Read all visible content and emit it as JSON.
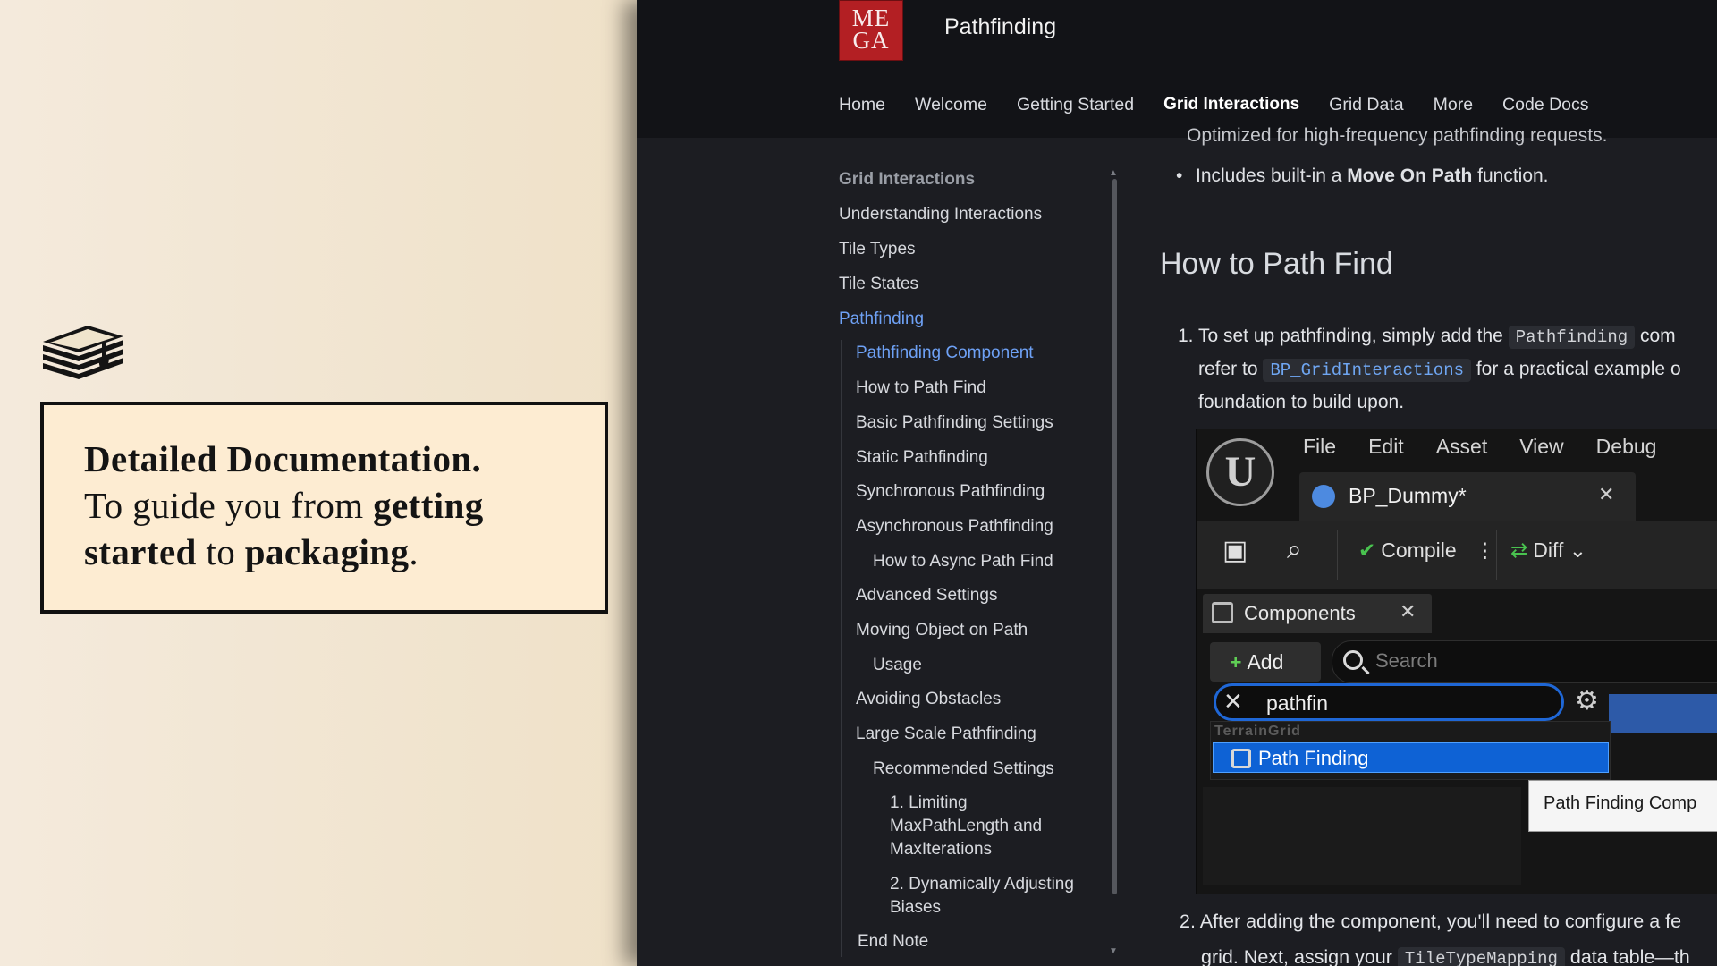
{
  "promo": {
    "headline": "Detailed Documentation.",
    "line_a": "To guide you from ",
    "bold_a": "getting",
    "bold_b": "started",
    "line_b": " to ",
    "bold_c": "packaging",
    "line_c": ".",
    "icon": "books-icon"
  },
  "header": {
    "logo_top": "ME",
    "logo_bottom": "GA",
    "title": "Pathfinding",
    "nav": [
      "Home",
      "Welcome",
      "Getting Started",
      "Grid Interactions",
      "Grid Data",
      "More",
      "Code Docs"
    ],
    "active_nav": "Grid Interactions"
  },
  "sidebar": {
    "section": "Grid Interactions",
    "items": [
      "Understanding Interactions",
      "Tile Types",
      "Tile States",
      "Pathfinding",
      "Pathfinding Component",
      "How to Path Find",
      "Basic Pathfinding Settings",
      "Static Pathfinding",
      "Synchronous Pathfinding",
      "Asynchronous Pathfinding",
      "How to Async Path Find",
      "Advanced Settings",
      "Moving Object on Path",
      "Usage",
      "Avoiding Obstacles",
      "Large Scale Pathfinding",
      "Recommended Settings",
      "1. Limiting",
      "MaxPathLength and",
      "MaxIterations",
      "2. Dynamically Adjusting",
      "Biases",
      "End Note"
    ]
  },
  "content": {
    "cut_line": "Optimized for high-frequency pathfinding requests.",
    "bullet_prefix": "Includes built-in a ",
    "bullet_bold": "Move On Path",
    "bullet_suffix": " function.",
    "heading": "How to Path Find",
    "step1_num": "1.",
    "step1_a": "To set up pathfinding, simply add the ",
    "step1_code": "Pathfinding",
    "step1_b": " com",
    "step1_c": "refer to ",
    "step1_code2": "BP_GridInteractions",
    "step1_d": " for a practical example o",
    "step1_e": "foundation to build upon.",
    "step2_a": "2. After adding the component, you'll need to configure a fe",
    "step2_b_pre": "grid. Next, assign your ",
    "step2_code": "TileTypeMapping",
    "step2_b_post": " data table—th"
  },
  "editor": {
    "menu": [
      "File",
      "Edit",
      "Asset",
      "View",
      "Debug"
    ],
    "tab": "BP_Dummy*",
    "compile": "Compile",
    "diff": "Diff",
    "components": "Components",
    "add": "Add",
    "search_placeholder": "Search",
    "filter_value": "pathfin",
    "category": "TerrainGrid",
    "result": "Path Finding",
    "tooltip": "Path Finding Comp",
    "colors": {
      "accent": "#0e62d5",
      "add_plus": "#5fcf55"
    }
  }
}
